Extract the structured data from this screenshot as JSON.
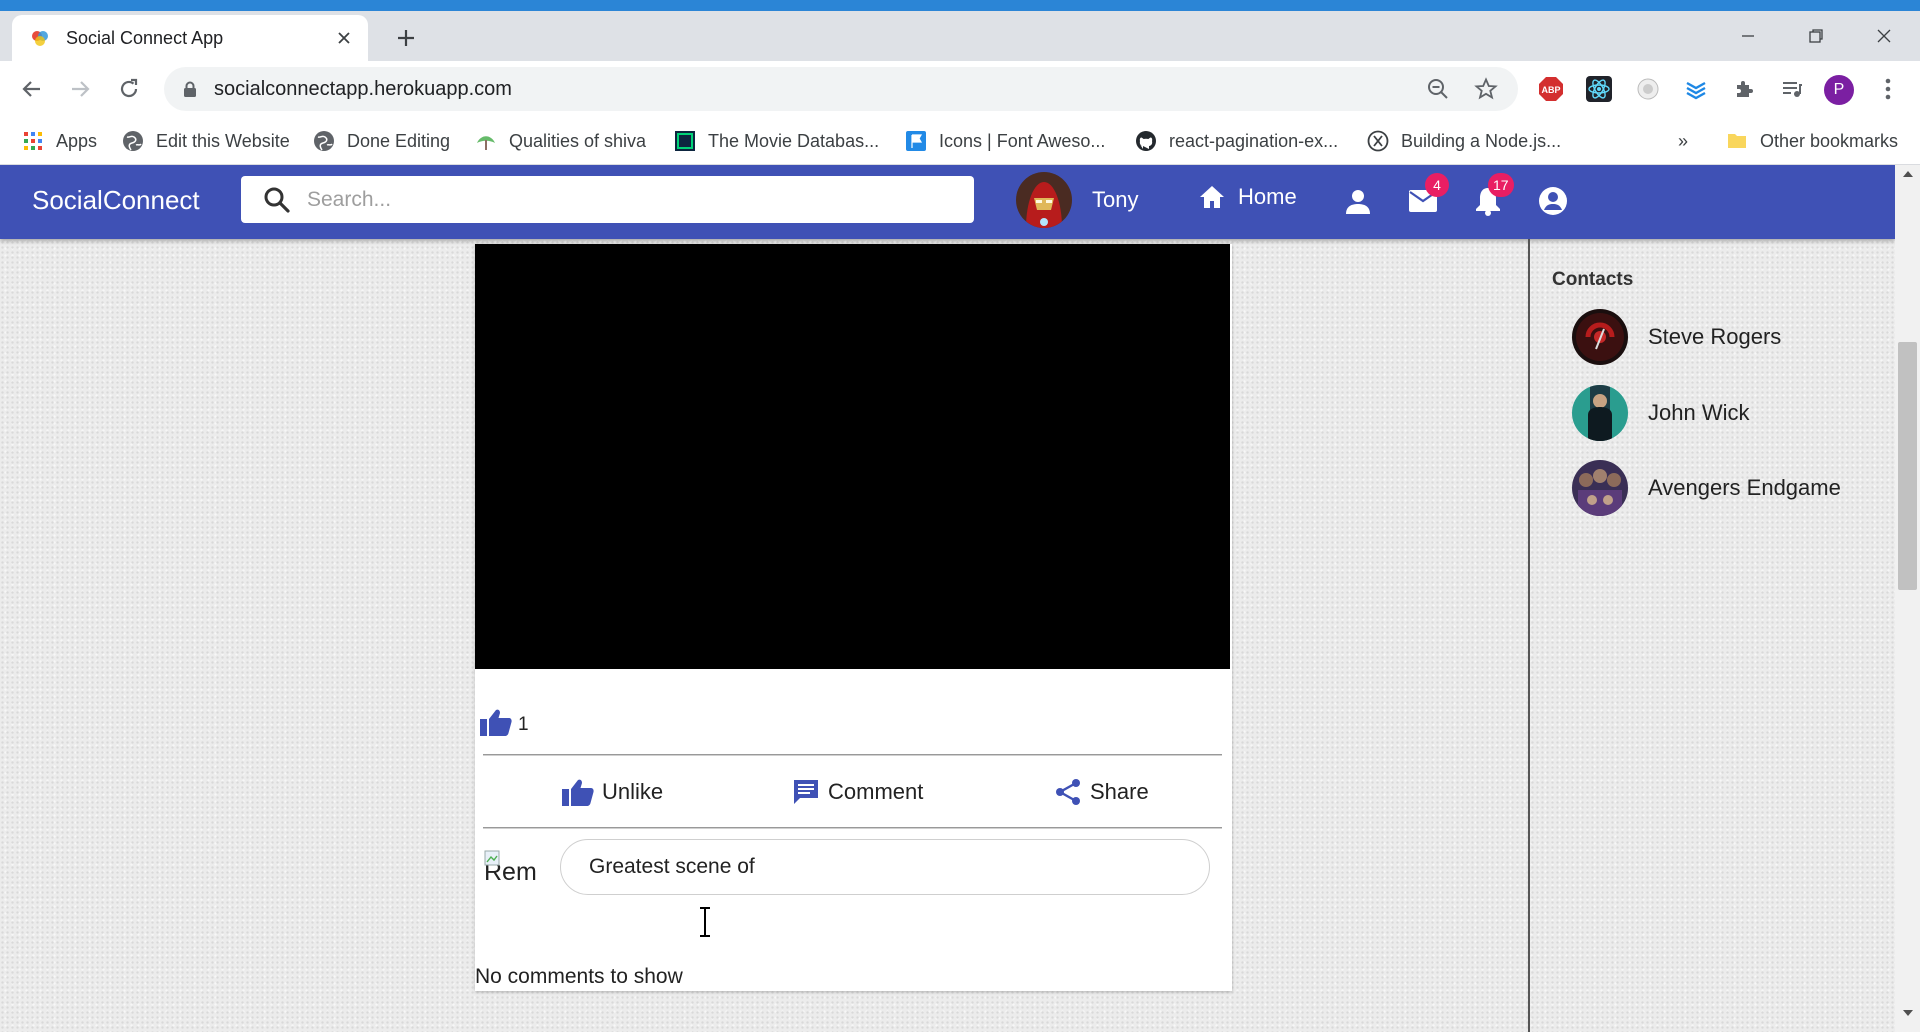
{
  "browser": {
    "tab_title": "Social Connect App",
    "url": "socialconnectapp.herokuapp.com",
    "profile_initial": "P",
    "bookmarks": [
      {
        "label": "Apps",
        "icon": "apps-grid-icon"
      },
      {
        "label": "Edit this Website",
        "icon": "globe-icon"
      },
      {
        "label": "Done Editing",
        "icon": "globe-icon"
      },
      {
        "label": "Qualities of shiva",
        "icon": "leaf-icon"
      },
      {
        "label": "The Movie Databas...",
        "icon": "movie-db-icon"
      },
      {
        "label": "Icons | Font Aweso...",
        "icon": "flag-icon"
      },
      {
        "label": "react-pagination-ex...",
        "icon": "github-icon"
      },
      {
        "label": "Building a Node.js...",
        "icon": "x-circle-icon"
      }
    ],
    "more_bookmarks": "»",
    "other_bookmarks": "Other bookmarks",
    "extensions": [
      "abp-icon",
      "react-devtools-icon",
      "extension-circle-icon",
      "layers-icon",
      "puzzle-icon",
      "media-queue-icon"
    ]
  },
  "app": {
    "brand": "SocialConnect",
    "search_placeholder": "Search...",
    "user_name": "Tony",
    "home_label": "Home",
    "messages_badge": "4",
    "notifications_badge": "17",
    "colors": {
      "appbar": "#3f51b5",
      "badge": "#e91e63"
    }
  },
  "post": {
    "likes_count": "1",
    "actions": {
      "unlike": "Unlike",
      "comment": "Comment",
      "share": "Share"
    },
    "commenter_avatar_alt": "Rem",
    "comment_value": "Greatest scene of",
    "no_comments": "No comments to show"
  },
  "contacts": {
    "title": "Contacts",
    "items": [
      {
        "name": "Steve Rogers"
      },
      {
        "name": "John Wick"
      },
      {
        "name": "Avengers Endgame"
      }
    ]
  }
}
